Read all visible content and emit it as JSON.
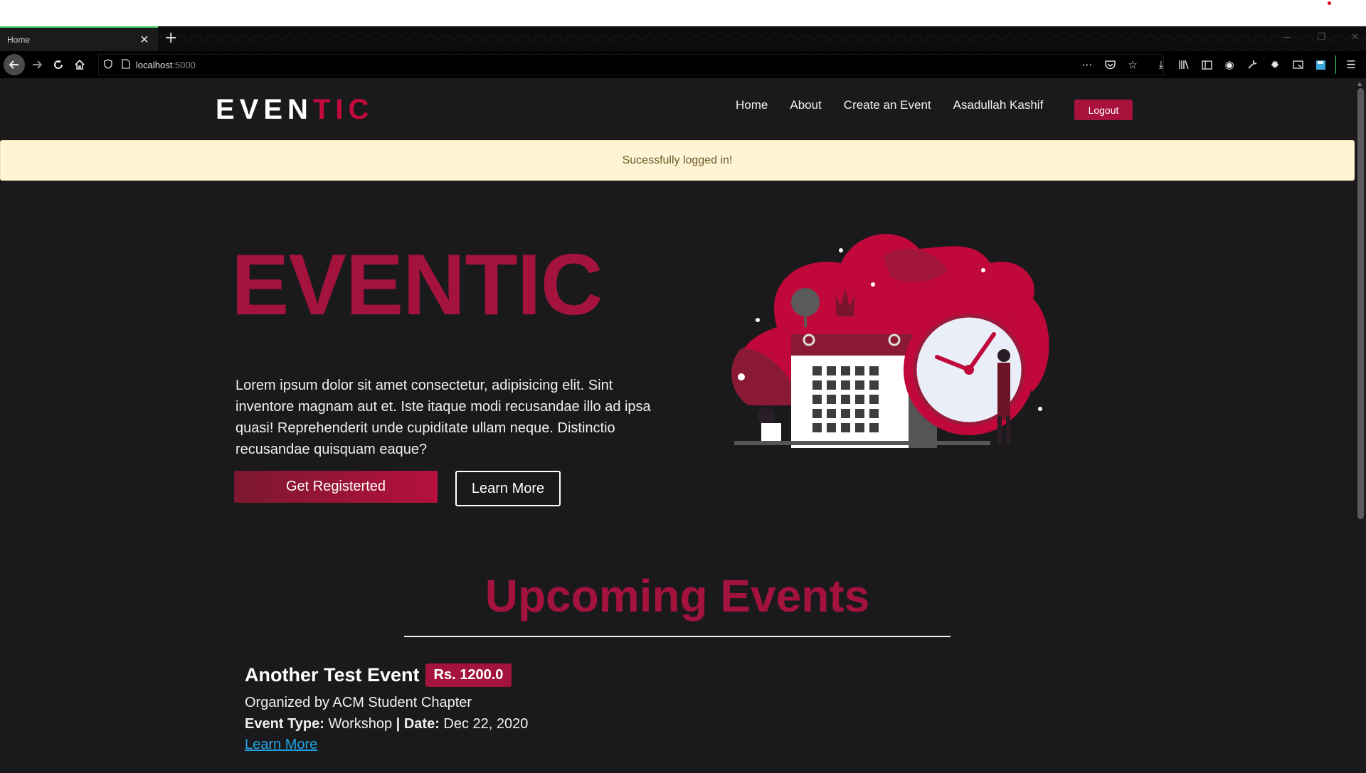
{
  "browser": {
    "tab_title": "Home",
    "tab_close": "✕",
    "new_tab": "+",
    "url_host": "localhost",
    "url_port": ":5000",
    "window_controls": [
      "—",
      "❐",
      "✕"
    ]
  },
  "site": {
    "brand_main": "EVEN",
    "brand_accent": "TIC",
    "nav": {
      "home": "Home",
      "about": "About",
      "create": "Create an Event",
      "user": "Asadullah Kashif",
      "logout": "Logout"
    },
    "alert": "Sucessfully logged in!"
  },
  "hero": {
    "title": "EVENTIC",
    "text": "Lorem ipsum dolor sit amet consectetur, adipisicing elit. Sint inventore magnam aut et. Iste itaque modi recusandae illo ad ipsa quasi! Reprehenderit unde cupiditate ullam neque. Distinctio recusandae quisquam eaque?",
    "register_label": "Get Registerted",
    "learn_label": "Learn More"
  },
  "upcoming": {
    "title": "Upcoming Events",
    "events": [
      {
        "name": "Another Test Event",
        "price": "Rs. 1200.0",
        "organizer": "Organized by ACM Student Chapter",
        "type_label": "Event Type:",
        "type_value": "Workshop",
        "separator": "|",
        "date_label": "Date:",
        "date_value": "Dec 22, 2020",
        "link": "Learn More"
      }
    ]
  },
  "colors": {
    "accent": "#a4123e",
    "page_bg": "#1a1a1c",
    "alert_bg": "#fff4d4",
    "link": "#20a3e4"
  },
  "icons": [
    "back-icon",
    "forward-icon",
    "reload-icon",
    "home-icon",
    "shield-icon",
    "page-icon",
    "more-icon",
    "pocket-icon",
    "star-icon",
    "download-icon",
    "library-icon",
    "sidebar-icon",
    "account-icon",
    "wrench-icon",
    "settings-icon",
    "screenshot-icon",
    "save-icon",
    "menu-icon"
  ]
}
